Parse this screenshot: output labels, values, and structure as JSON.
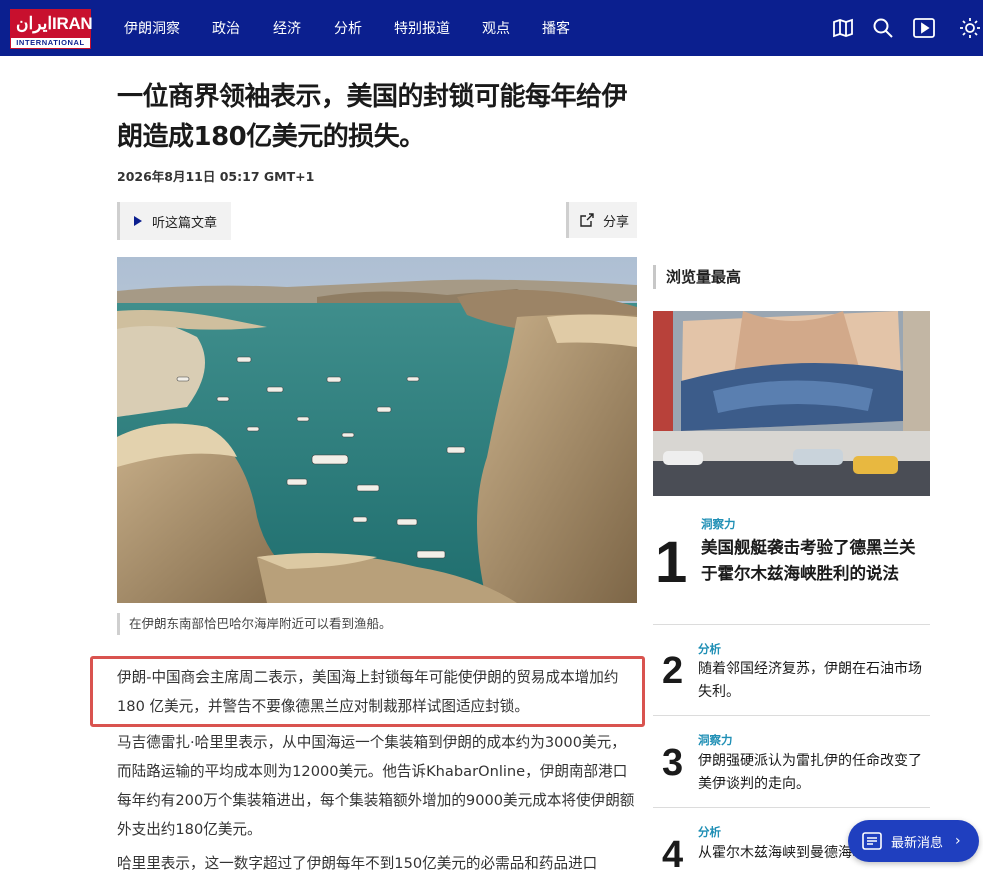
{
  "header": {
    "logo_farsi": "ایران",
    "logo_text": "IRAN",
    "logo_sub": "INTERNATIONAL",
    "nav": [
      "伊朗洞察",
      "政治",
      "经济",
      "分析",
      "特别报道",
      "观点",
      "播客"
    ],
    "icons": [
      "map-icon",
      "search-icon",
      "video-play-icon",
      "brightness-icon"
    ],
    "colors": {
      "bar": "#0b1f8f",
      "logo_red": "#c8102e"
    }
  },
  "article": {
    "title": "一位商界领袖表示，美国的封锁可能每年给伊朗造成180亿美元的损失。",
    "date": "2026年8月11日 05:17 GMT+1",
    "listen_label": "听这篇文章",
    "share_label": "分享",
    "caption": "在伊朗东南部恰巴哈尔海岸附近可以看到渔船。",
    "paragraphs": [
      "伊朗-中国商会主席周二表示，美国海上封锁每年可能使伊朗的贸易成本增加约 180 亿美元，并警告不要像德黑兰应对制裁那样试图适应封锁。",
      "马吉德雷扎·哈里里表示，从中国海运一个集装箱到伊朗的成本约为3000美元，而陆路运输的平均成本则为12000美元。他告诉KhabarOnline，伊朗南部港口每年约有200万个集装箱进出，每个集装箱额外增加的9000美元成本将使伊朗额外支出约180亿美元。",
      "哈里里表示，这一数字超过了伊朗每年不到150亿美元的必需品和药品进口"
    ]
  },
  "sidebar": {
    "heading": "浏览量最高",
    "items": [
      {
        "rank": "1",
        "category": "洞察力",
        "title": "美国舰艇袭击考验了德黑兰关于霍尔木兹海峡胜利的说法"
      },
      {
        "rank": "2",
        "category": "分析",
        "title": "随着邻国经济复苏，伊朗在石油市场失利。"
      },
      {
        "rank": "3",
        "category": "洞察力",
        "title": "伊朗强硬派认为雷扎伊的任命改变了美伊谈判的走向。"
      },
      {
        "rank": "4",
        "category": "分析",
        "title": "从霍尔木兹海峡到曼德海峡：汇聚于重要的航运通道"
      }
    ],
    "category_color": "#1f8fb5"
  },
  "latest_button": {
    "label": "最新消息"
  }
}
